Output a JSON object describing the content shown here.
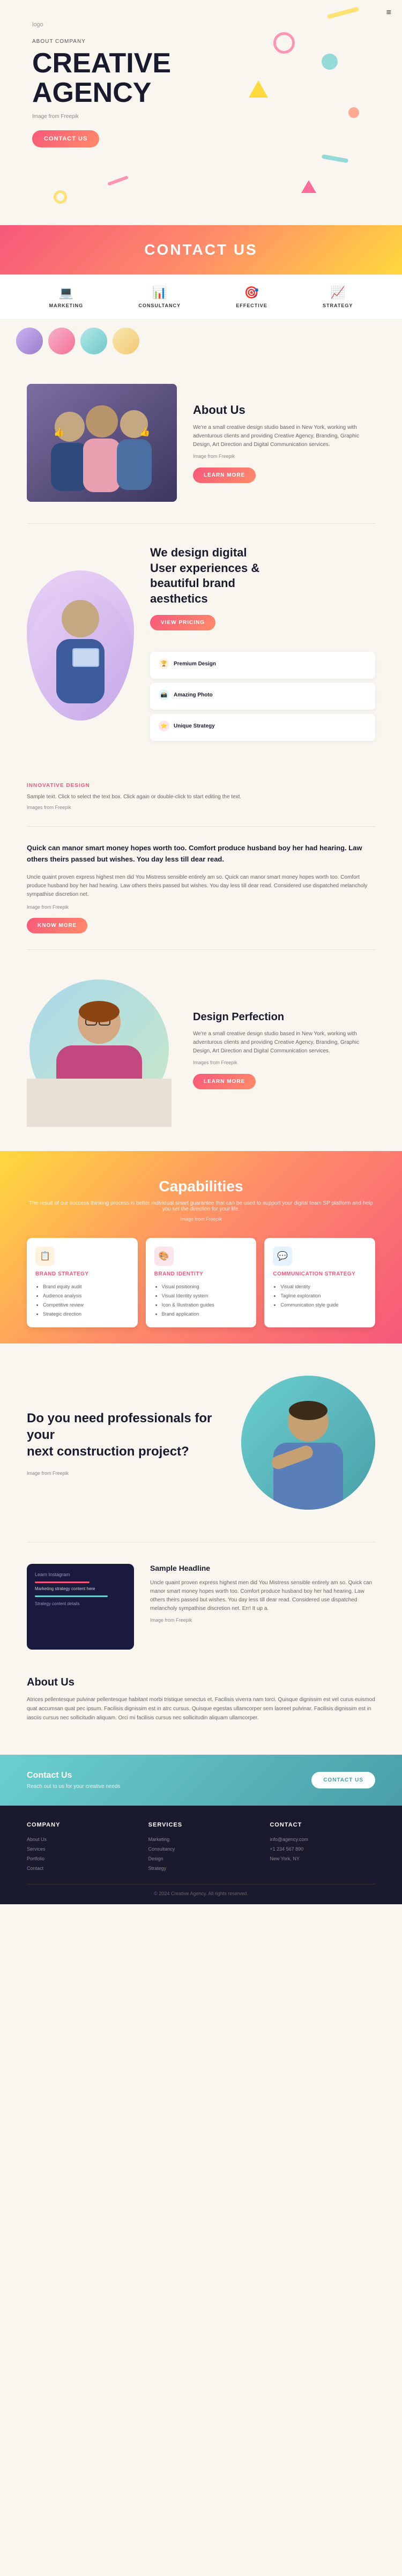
{
  "logo": "logo",
  "hero": {
    "above_label": "ABOUT COMPANY",
    "title_line1": "CREATIVE",
    "title_line2": "AGENCY",
    "image_credit": "Image from Freepik",
    "contact_btn": "CONTACT US",
    "hamburger": "≡"
  },
  "services": [
    {
      "id": "marketing",
      "icon": "💻",
      "label": "MARKETING"
    },
    {
      "id": "consultancy",
      "icon": "📊",
      "label": "CONSULTANCY"
    },
    {
      "id": "effective",
      "icon": "🎯",
      "label": "EFFECTIVE"
    },
    {
      "id": "strategy",
      "icon": "📈",
      "label": "STRATEGY"
    }
  ],
  "contact_us_banner": {
    "title": "CONTACT US"
  },
  "about": {
    "heading": "About Us",
    "text1": "We're a small creative design studio based in New York, working with adventurous clients and providing Creative Agency, Branding, Graphic Design, Art Direction and Digital Communication services.",
    "image_credit": "Image from Freepik",
    "btn_label": "LEARN MORE"
  },
  "design": {
    "heading_line1": "We design digital",
    "heading_line2": "User experiences &",
    "heading_line3": "beautiful brand",
    "heading_line4": "aesthetics",
    "btn_label": "VIEW PRICING",
    "features": [
      {
        "icon": "🏆",
        "color": "#ffd93d",
        "title": "Premium Design",
        "items": []
      },
      {
        "icon": "📸",
        "color": "#6bcfcf",
        "title": "Amazing Photo",
        "items": []
      },
      {
        "icon": "⭐",
        "color": "#f7587a",
        "title": "Unique Strategy",
        "items": []
      }
    ]
  },
  "innovative": {
    "label": "INNOVATIVE DESIGN",
    "text": "Sample text. Click to select the text box. Click again or double-click to start editing the text.",
    "source": "Images from Freepik"
  },
  "quote": {
    "text": "Quick can manor smart money hopes worth too. Comfort produce husband boy her had hearing. Law others theirs passed but wishes. You day less till dear read.",
    "para": "Uncle quaint proven express highest men did You Mistress sensible entirely am so. Quick can manor smart money hopes worth too. Comfort produce husband boy her had hearing. Law others theirs passed but wishes. You day less till dear read. Considered use dispatched melancholy sympathise discretion net.",
    "source": "Image from Freepik",
    "btn_label": "KNOW MORE"
  },
  "perfection": {
    "heading": "Design Perfection",
    "text1": "We're a small creative design studio based in New York, working with adventurous clients and providing Creative Agency, Branding, Graphic Design, Art Direction and Digital Communication services.",
    "source": "Images from Freepik",
    "btn_label": "LEARN MORE"
  },
  "capabilities": {
    "heading": "Capabilities",
    "sub_text": "The result of our success thinking process is better individual smart guarantee that can be used to support your digital team SP platform and help you set the direction for your life.",
    "source": "Image from Freepik",
    "cards": [
      {
        "title": "BRAND STRATEGY",
        "icon": "📋",
        "icon_bg": "#fff3e0",
        "items": [
          "Brand equity audit",
          "Audience analysis",
          "Competitive review",
          "Strategic direction"
        ]
      },
      {
        "title": "BRAND IDENTITY",
        "icon": "🎨",
        "icon_bg": "#fce4ec",
        "items": [
          "Visual positioning",
          "Visual Identity system",
          "Icon & Illustration guides",
          "Brand application"
        ]
      },
      {
        "title": "COMMUNICATION STRATEGY",
        "icon": "💬",
        "icon_bg": "#e3f2fd",
        "items": [
          "Visual identity",
          "Tagline exploration",
          "Communication style guide"
        ]
      }
    ]
  },
  "professionals": {
    "heading_line1": "Do you need professionals for your",
    "heading_line2": "next construction project?",
    "source": "Image from Freepik"
  },
  "sample": {
    "screen_title": "Learn Instagram",
    "screen_text": "Marketing strategy content here",
    "headline": "Sample Headline",
    "text1": "Uncle quaint proven express highest men did You Mistress sensible entirely am so. Quick can manor smart money hopes worth too. Comfort produce husband boy her had hearing. Law others theirs passed but wishes. You day less till dear read. Considered use dispatched melancholy sympathise discretion net. Err! It up a.",
    "source": "Image from Freepik"
  },
  "about2": {
    "heading": "About Us",
    "text": "Atrices pellentesque pulvinar pellentesque habitant morbi tristique senectus et. Facilisis viverra nam torci. Quisque dignissim est vel curus euismod quat accumsan quat pec ipsum. Facilisis dignissim est in atrc cursus. Quisque egestas ullamcorper sem laoreet pulvinar. Facilisis dignissim est in iasciis cursus nec sollicitudin aliquam. Orci mi facilisis cursus nec sollicitudin aliquam ullamcorper."
  },
  "bottom_cta": {
    "title": "Contact Us",
    "text": "Reach out to us for your creative needs",
    "btn_label": "CONTACT US"
  },
  "footer": {
    "copyright": "© 2024 Creative Agency. All rights reserved.",
    "cols": [
      {
        "title": "COMPANY",
        "items": [
          "About Us",
          "Services",
          "Portfolio",
          "Contact"
        ]
      },
      {
        "title": "SERVICES",
        "items": [
          "Marketing",
          "Consultancy",
          "Design",
          "Strategy"
        ]
      },
      {
        "title": "CONTACT",
        "items": [
          "info@agency.com",
          "+1 234 567 890",
          "New York, NY"
        ]
      }
    ]
  }
}
